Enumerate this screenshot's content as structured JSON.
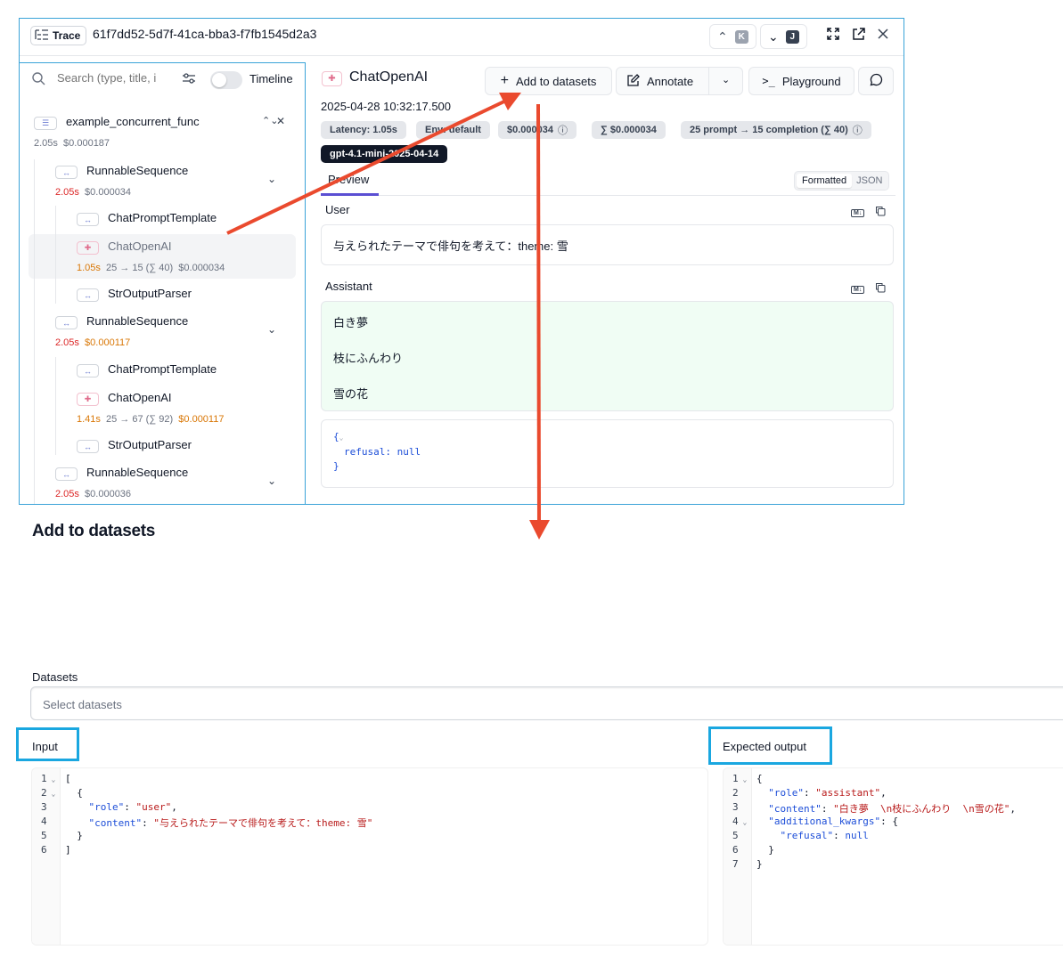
{
  "trace": {
    "badge_label": "Trace",
    "id": "61f7dd52-5d7f-41ca-bba3-f7fb1545d2a3",
    "prev_key": "K",
    "next_key": "J"
  },
  "sidebar": {
    "search_placeholder": "Search (type, title, i",
    "timeline_label": "Timeline",
    "root": {
      "name": "example_concurrent_func",
      "latency": "2.05s",
      "cost": "$0.000187"
    },
    "items": [
      {
        "name": "RunnableSequence",
        "latency": "2.05s",
        "cost": "$0.000034"
      },
      {
        "name": "ChatPromptTemplate"
      },
      {
        "name": "ChatOpenAI",
        "latency": "1.05s",
        "tokens": "25 → 15 (∑ 40)",
        "cost": "$0.000034"
      },
      {
        "name": "StrOutputParser"
      },
      {
        "name": "RunnableSequence",
        "latency": "2.05s",
        "cost": "$0.000117"
      },
      {
        "name": "ChatPromptTemplate"
      },
      {
        "name": "ChatOpenAI",
        "latency": "1.41s",
        "tokens": "25 → 67 (∑ 92)",
        "cost": "$0.000117"
      },
      {
        "name": "StrOutputParser"
      },
      {
        "name": "RunnableSequence",
        "latency": "2.05s",
        "cost": "$0.000036"
      }
    ]
  },
  "detail": {
    "title": "ChatOpenAI",
    "add_to_datasets": "Add to datasets",
    "annotate": "Annotate",
    "playground": "Playground",
    "timestamp": "2025-04-28 10:32:17.500",
    "chips": {
      "latency": "Latency: 1.05s",
      "env": "Env: default",
      "cost": "$0.000034",
      "total_cost": "∑ $0.000034",
      "tokens": "25 prompt → 15 completion (∑ 40)",
      "model": "gpt-4.1-mini-2025-04-14"
    },
    "tab_preview": "Preview",
    "toggle_formatted": "Formatted",
    "toggle_json": "JSON",
    "user_label": "User",
    "user_message": "与えられたテーマで俳句を考えて：theme: 雪",
    "assistant_label": "Assistant",
    "assistant_lines": [
      "白き夢",
      "枝にふんわり",
      "雪の花"
    ],
    "extra_json": {
      "open": "{",
      "line": "refusal: null",
      "close": "}"
    },
    "md_badge": "M↓"
  },
  "form": {
    "title": "Add to datasets",
    "datasets_label": "Datasets",
    "datasets_placeholder": "Select datasets",
    "input_label": "Input",
    "expected_output_label": "Expected output"
  },
  "input_editor": {
    "line_numbers": [
      "1",
      "2",
      "3",
      "4",
      "5",
      "6"
    ]
  },
  "output_editor": {
    "line_numbers": [
      "1",
      "2",
      "3",
      "4",
      "5",
      "6",
      "7"
    ]
  },
  "colors": {
    "accent_border": "#1aa7e0",
    "arrow": "#ea4a2e",
    "tab_underline": "#5b4fd3",
    "latency_red": "#dc2626",
    "latency_amber": "#d97706"
  }
}
